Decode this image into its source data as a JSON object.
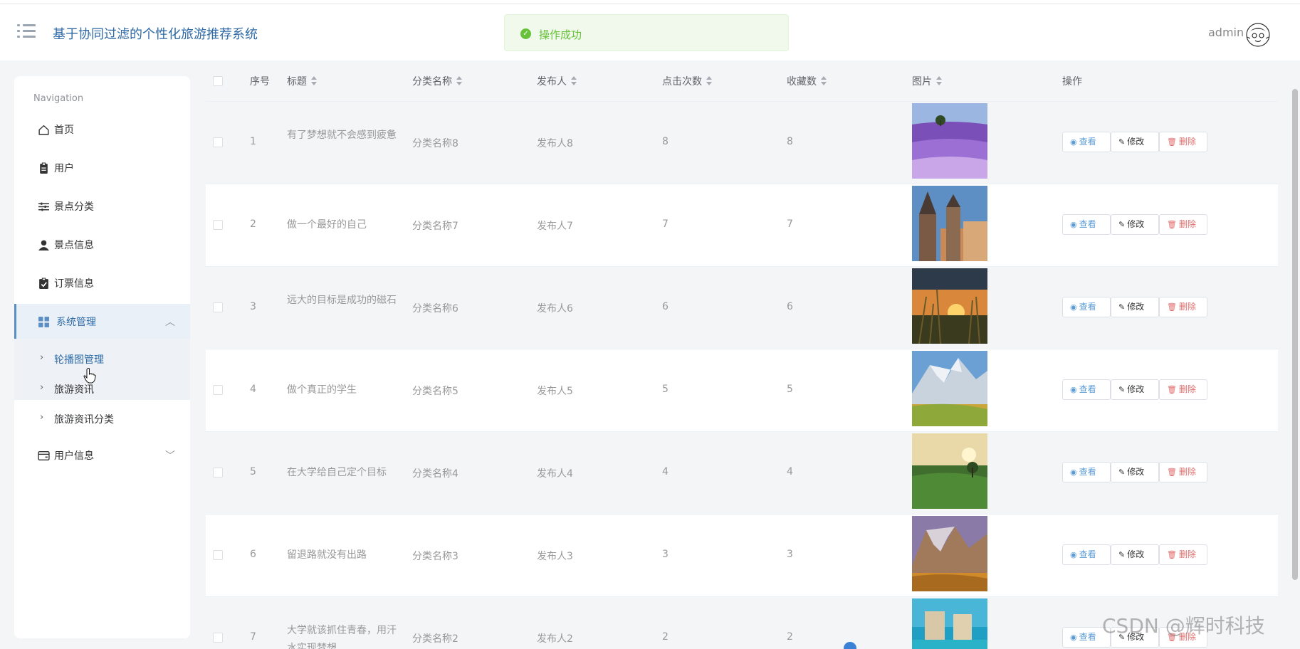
{
  "header": {
    "title": "基于协同过滤的个性化旅游推荐系统",
    "user": "admin",
    "toast": "操作成功"
  },
  "sidebar": {
    "caption": "Navigation",
    "items": [
      {
        "label": "首页",
        "icon": "home-icon"
      },
      {
        "label": "用户",
        "icon": "clipboard-icon"
      },
      {
        "label": "景点分类",
        "icon": "sliders-icon"
      },
      {
        "label": "景点信息",
        "icon": "person-icon"
      },
      {
        "label": "订票信息",
        "icon": "checklist-icon"
      },
      {
        "label": "系统管理",
        "icon": "grid-icon"
      },
      {
        "label": "用户信息",
        "icon": "card-icon"
      }
    ],
    "submenu": [
      {
        "label": "轮播图管理"
      },
      {
        "label": "旅游资讯"
      },
      {
        "label": "旅游资讯分类"
      }
    ]
  },
  "table": {
    "columns": [
      "序号",
      "标题",
      "分类名称",
      "发布人",
      "点击次数",
      "收藏数",
      "图片",
      "操作"
    ],
    "actions": {
      "view": "查看",
      "edit": "修改",
      "delete": "删除"
    },
    "rows": [
      {
        "no": "1",
        "title": "有了梦想就不会感到疲惫",
        "category": "分类名称8",
        "publisher": "发布人8",
        "clicks": "8",
        "favorites": "8"
      },
      {
        "no": "2",
        "title": "做一个最好的自己",
        "category": "分类名称7",
        "publisher": "发布人7",
        "clicks": "7",
        "favorites": "7"
      },
      {
        "no": "3",
        "title": "远大的目标是成功的磁石",
        "category": "分类名称6",
        "publisher": "发布人6",
        "clicks": "6",
        "favorites": "6"
      },
      {
        "no": "4",
        "title": "做个真正的学生",
        "category": "分类名称5",
        "publisher": "发布人5",
        "clicks": "5",
        "favorites": "5"
      },
      {
        "no": "5",
        "title": "在大学给自己定个目标",
        "category": "分类名称4",
        "publisher": "发布人4",
        "clicks": "4",
        "favorites": "4"
      },
      {
        "no": "6",
        "title": "留退路就没有出路",
        "category": "分类名称3",
        "publisher": "发布人3",
        "clicks": "3",
        "favorites": "3"
      },
      {
        "no": "7",
        "title": "大学就该抓住青春，用汗水实现梦想",
        "category": "分类名称2",
        "publisher": "发布人2",
        "clicks": "2",
        "favorites": "2"
      }
    ]
  },
  "watermark": "CSDN @辉时科技"
}
